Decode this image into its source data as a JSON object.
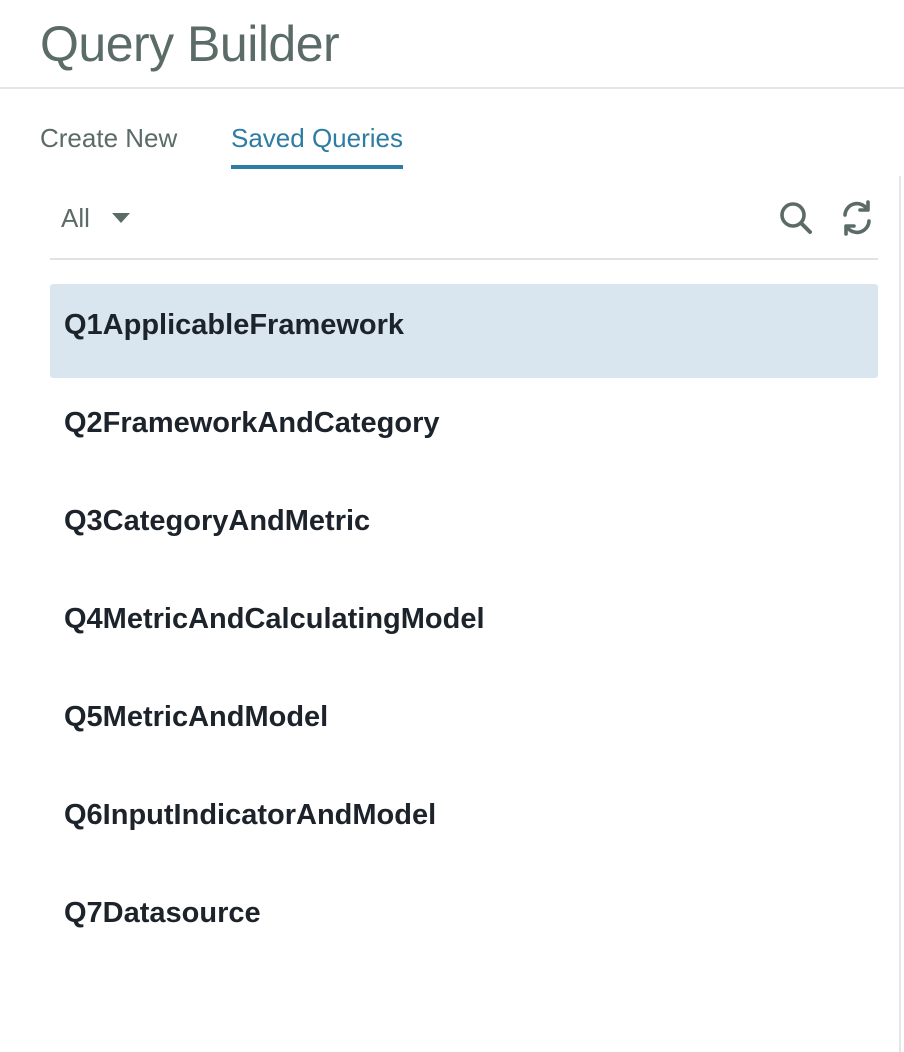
{
  "header": {
    "title": "Query Builder"
  },
  "tabs": [
    {
      "label": "Create New",
      "active": false
    },
    {
      "label": "Saved Queries",
      "active": true
    }
  ],
  "toolbar": {
    "filter_value": "All",
    "search_icon": "search-icon",
    "refresh_icon": "refresh-icon"
  },
  "queries": [
    {
      "label": "Q1ApplicableFramework",
      "selected": true
    },
    {
      "label": "Q2FrameworkAndCategory",
      "selected": false
    },
    {
      "label": "Q3CategoryAndMetric",
      "selected": false
    },
    {
      "label": "Q4MetricAndCalculatingModel",
      "selected": false
    },
    {
      "label": "Q5MetricAndModel",
      "selected": false
    },
    {
      "label": "Q6InputIndicatorAndModel",
      "selected": false
    },
    {
      "label": "Q7Datasource",
      "selected": false
    }
  ],
  "colors": {
    "accent": "#2c7ca3",
    "muted_text": "#5b6b68",
    "selected_row": "#dae6ef",
    "item_text": "#1d232b"
  }
}
